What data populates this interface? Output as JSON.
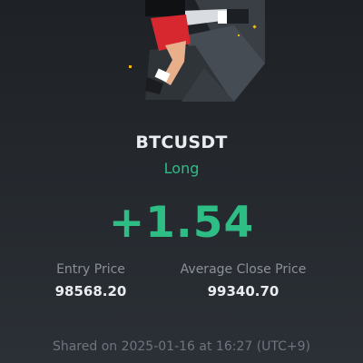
{
  "trade": {
    "symbol": "BTCUSDT",
    "side": "Long",
    "pnl": "+1.54"
  },
  "stats": {
    "entry_label": "Entry Price",
    "entry_value": "98568.20",
    "close_label": "Average Close Price",
    "close_value": "99340.70"
  },
  "footer": {
    "shared": "Shared on 2025-01-16 at 16:27 (UTC+9)"
  },
  "colors": {
    "positive": "#2ebd85",
    "background": "#24282d",
    "accent_gold": "#f0b90b"
  },
  "illustration": {
    "icon": "trader-character-illustration"
  }
}
